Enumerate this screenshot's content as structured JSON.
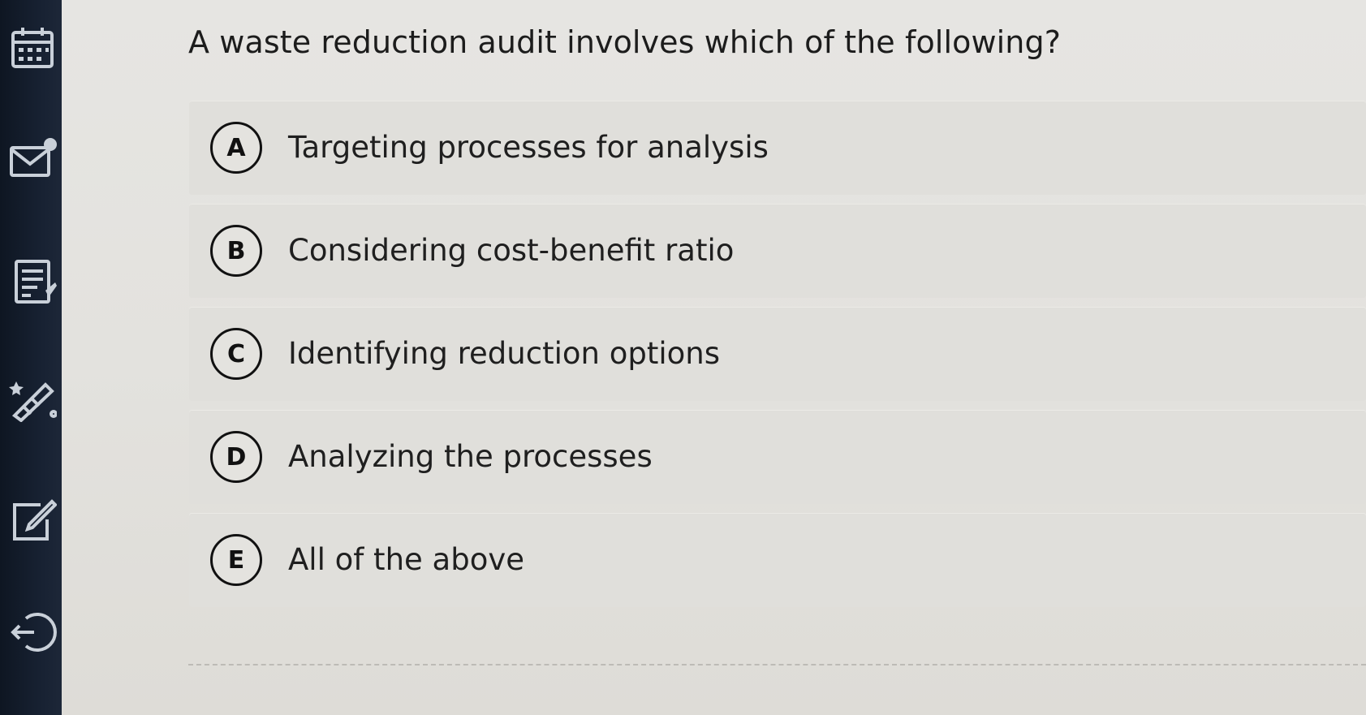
{
  "sidebar": {
    "icons": [
      {
        "name": "calendar-icon"
      },
      {
        "name": "mail-icon"
      },
      {
        "name": "notes-icon"
      },
      {
        "name": "tools-icon"
      },
      {
        "name": "edit-icon"
      },
      {
        "name": "logout-icon"
      }
    ]
  },
  "question": {
    "text": "A waste reduction audit involves which of the following?"
  },
  "options": [
    {
      "letter": "A",
      "text": "Targeting processes for analysis"
    },
    {
      "letter": "B",
      "text": "Considering cost-benefit ratio"
    },
    {
      "letter": "C",
      "text": "Identifying reduction options"
    },
    {
      "letter": "D",
      "text": "Analyzing the processes"
    },
    {
      "letter": "E",
      "text": "All of the above"
    }
  ],
  "colors": {
    "sidebar_bg": "#152030",
    "page_bg": "#e4e3df",
    "option_bg": "#e0dfdb",
    "text": "#1c1c1c"
  }
}
